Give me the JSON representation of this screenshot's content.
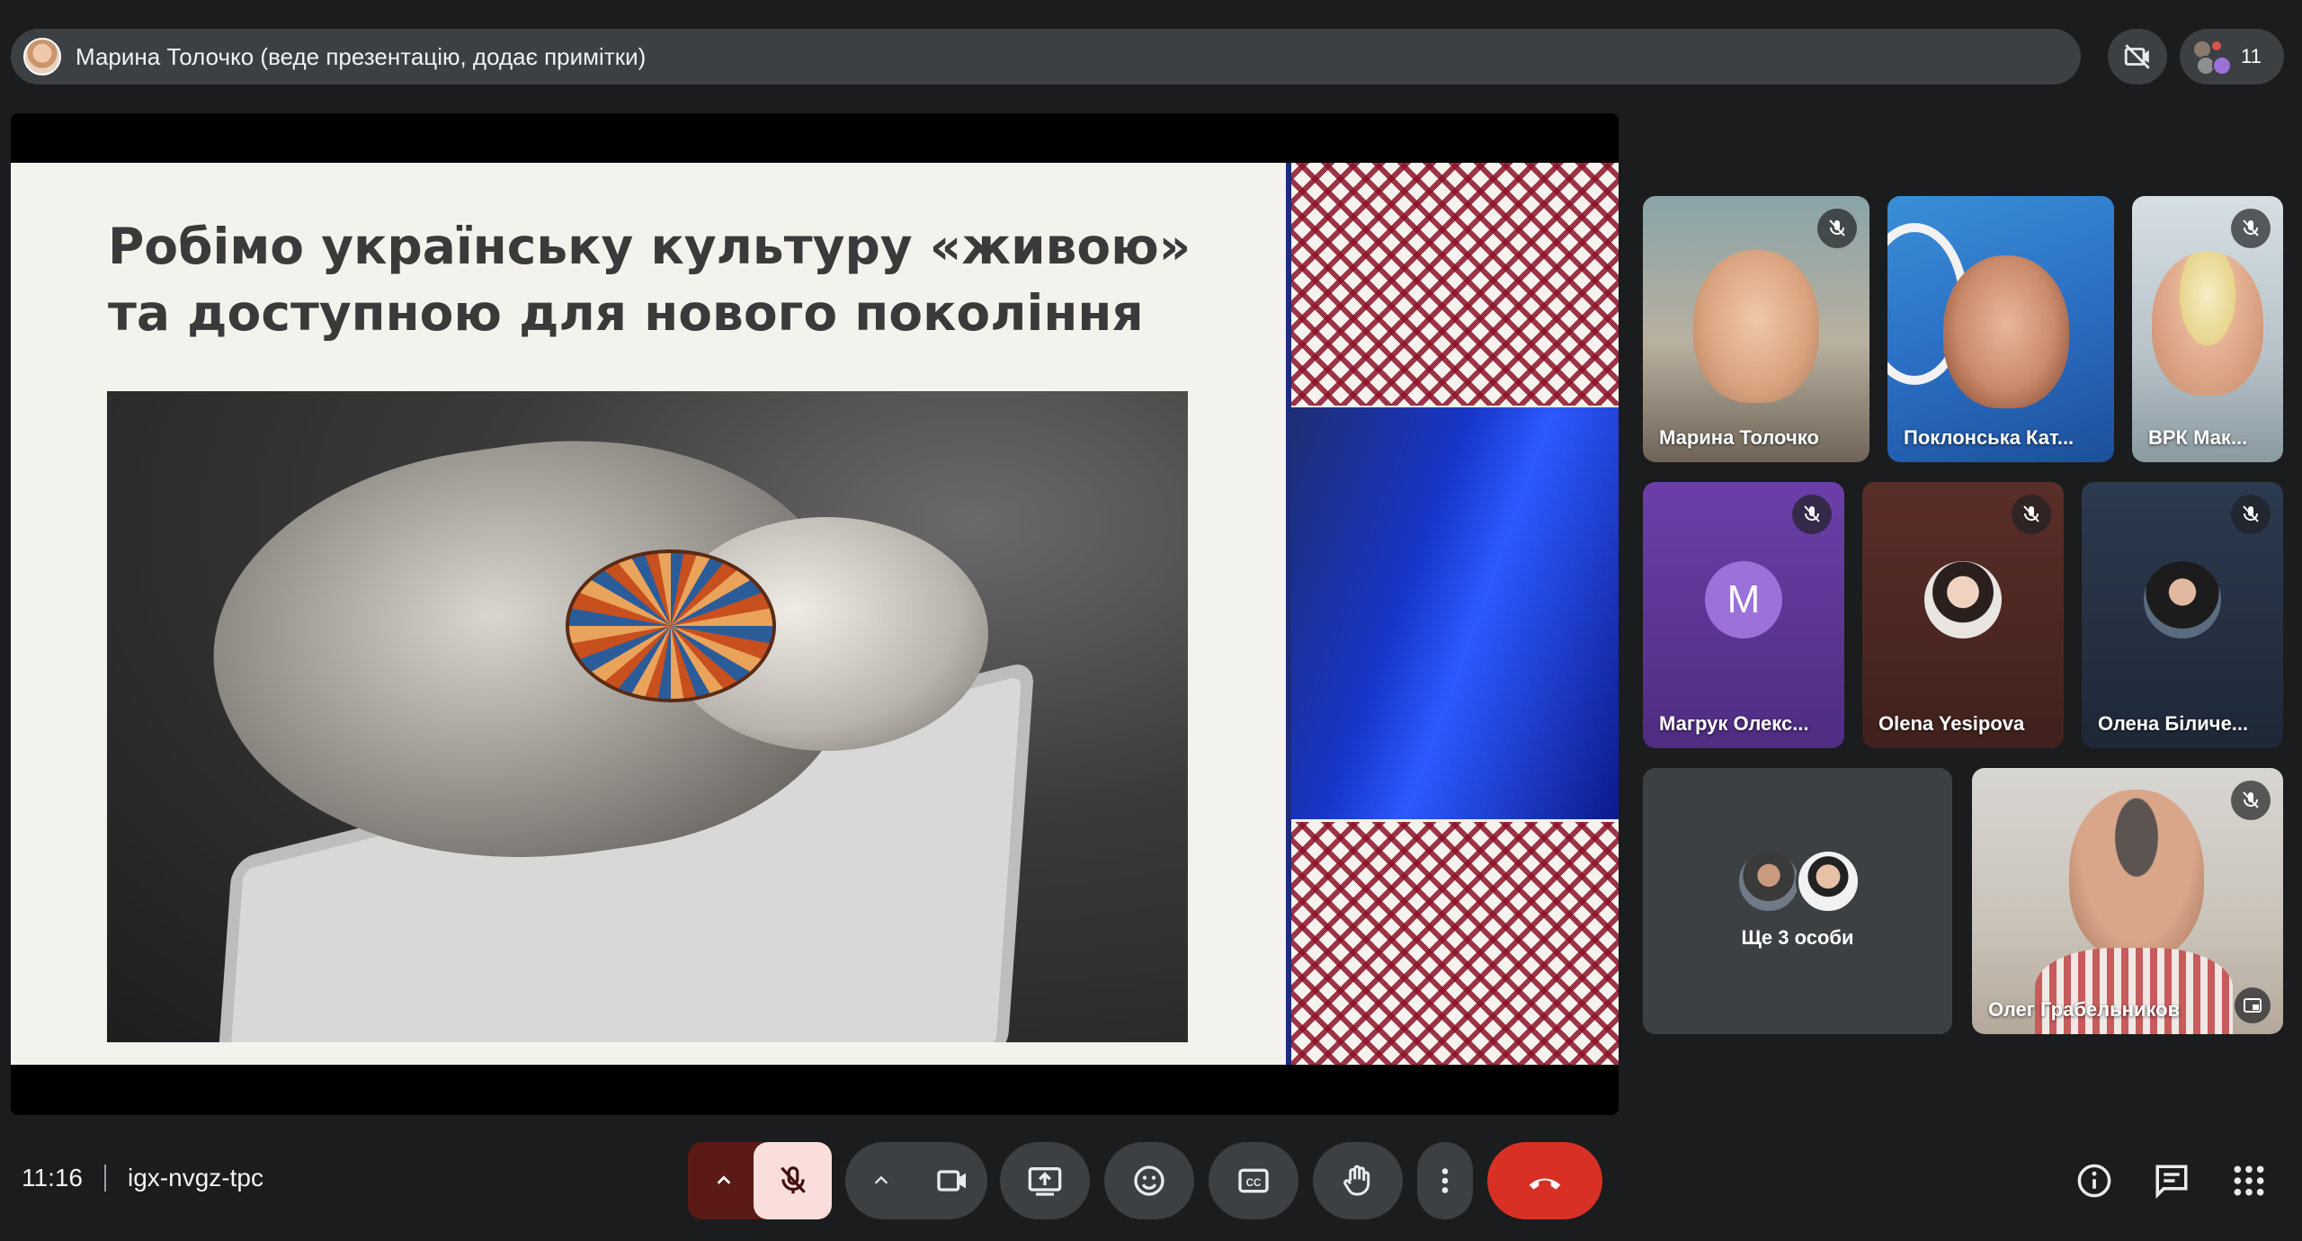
{
  "presenter": {
    "status_text": "Марина Толочко (веде презентацію, додає примітки)"
  },
  "top_controls": {
    "participants_count": "11"
  },
  "slide": {
    "title_line1": "Робімо українську культуру «живою»",
    "title_line2": "та доступною для нового покоління"
  },
  "participants": [
    {
      "name": "Марина Толочко",
      "muted": true
    },
    {
      "name": "Поклонська Кат...",
      "muted": false
    },
    {
      "name": "ВРК Мак...",
      "muted": true
    },
    {
      "name": "Магрук Олекс...",
      "muted": true,
      "avatar_letter": "M"
    },
    {
      "name": "Olena Yesipova",
      "muted": true
    },
    {
      "name": "Олена Біличе...",
      "muted": true
    },
    {
      "name": "Олег Грабельников",
      "muted": true
    }
  ],
  "more_people": {
    "label": "Ще 3 особи"
  },
  "meeting": {
    "time": "11:16",
    "code": "igx-nvgz-tpc"
  },
  "colors": {
    "end_call": "#d93025",
    "mic_muted_bg": "#f9dedc",
    "control_bg": "#3c4043",
    "page_bg": "#1b1c1e"
  },
  "icons": [
    "camera-off-icon",
    "people-icon",
    "mic-off-icon",
    "chevron-up-icon",
    "camera-icon",
    "present-screen-icon",
    "emoji-icon",
    "captions-icon",
    "raise-hand-icon",
    "more-options-icon",
    "end-call-icon",
    "info-icon",
    "chat-icon",
    "activities-icon",
    "pip-icon"
  ]
}
